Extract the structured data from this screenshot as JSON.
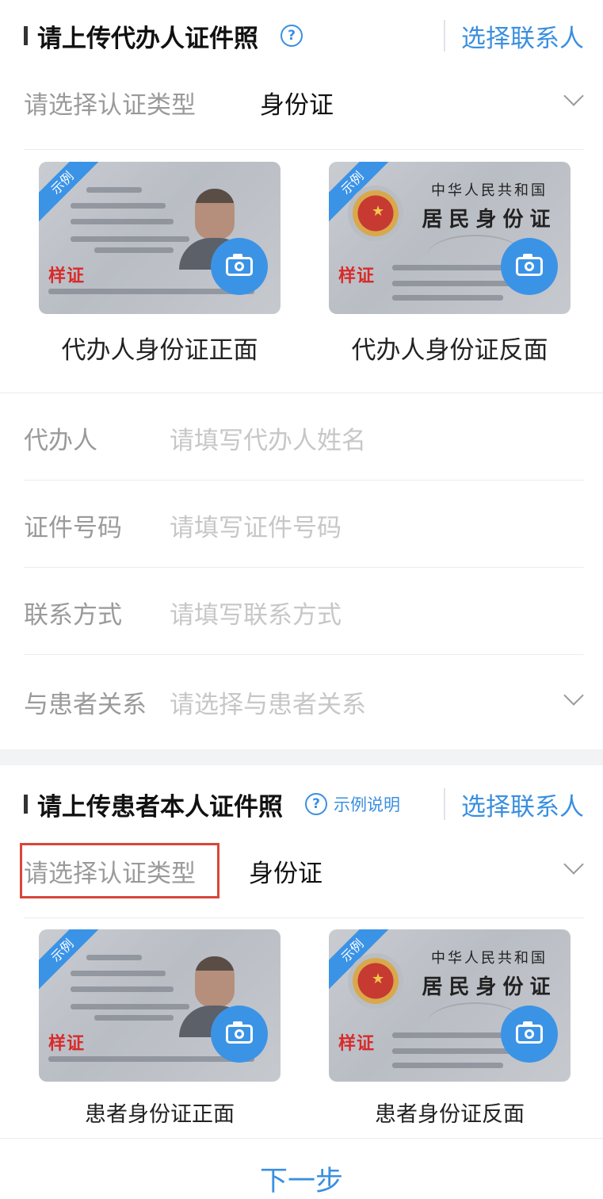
{
  "agent_section": {
    "title": "请上传代办人证件照",
    "help_icon": "?",
    "pick_contact": "选择联系人",
    "cert_type_label": "请选择认证类型",
    "cert_type_value": "身份证",
    "cards": [
      {
        "ribbon": "示例",
        "stamp": "样证",
        "caption": "代办人身份证正面"
      },
      {
        "ribbon": "示例",
        "stamp": "样证",
        "caption": "代办人身份证反面",
        "title1": "中华人民共和国",
        "title2": "居民身份证"
      }
    ],
    "fields": [
      {
        "label": "代办人",
        "placeholder": "请填写代办人姓名"
      },
      {
        "label": "证件号码",
        "placeholder": "请填写证件号码"
      },
      {
        "label": "联系方式",
        "placeholder": "请填写联系方式"
      },
      {
        "label": "与患者关系",
        "placeholder": "请选择与患者关系"
      }
    ]
  },
  "patient_section": {
    "title": "请上传患者本人证件照",
    "help_icon": "?",
    "help_text": "示例说明",
    "pick_contact": "选择联系人",
    "cert_type_label": "请选择认证类型",
    "cert_type_value": "身份证",
    "cards": [
      {
        "ribbon": "示例",
        "stamp": "样证",
        "caption": "患者身份证正面"
      },
      {
        "ribbon": "示例",
        "stamp": "样证",
        "caption": "患者身份证反面",
        "title1": "中华人民共和国",
        "title2": "居民身份证"
      }
    ]
  },
  "footer": {
    "next_label": "下一步"
  },
  "colors": {
    "accent": "#3a8fe0",
    "highlight_box": "#d9463a"
  }
}
